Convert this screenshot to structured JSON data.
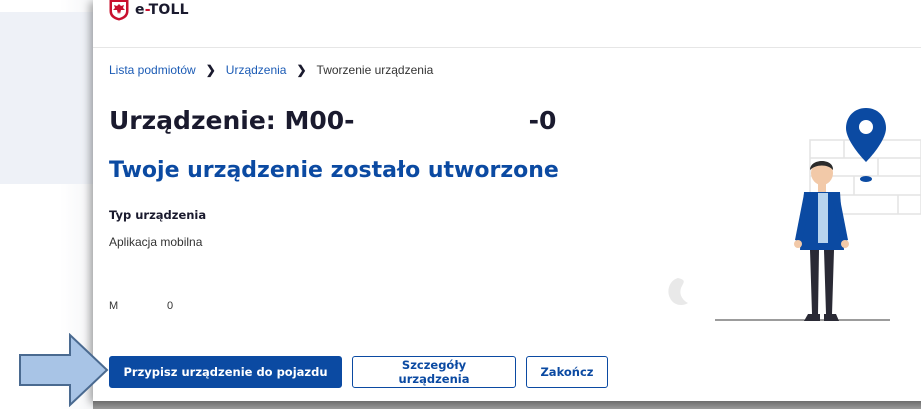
{
  "app": {
    "logo_text": "e-TOLL",
    "logo_prefix": "e",
    "logo_dash": "-",
    "logo_suffix": "TOLL"
  },
  "breadcrumb": {
    "items": [
      {
        "label": "Lista podmiotów",
        "link": true
      },
      {
        "label": "Urządzenia",
        "link": true
      },
      {
        "label": "Tworzenie urządzenia",
        "link": false
      }
    ],
    "separator_icon": "chevron-right-icon"
  },
  "page": {
    "title": "Urządzenie: M00-                    -0",
    "subtitle": "Twoje urządzenie zostało utworzone"
  },
  "device": {
    "type_label": "Typ urządzenia",
    "type_value": "Aplikacja mobilna",
    "serial": "M                0"
  },
  "actions": {
    "assign_label": "Przypisz urządzenie do pojazdu",
    "details_label": "Szczegóły urządzenia",
    "finish_label": "Zakończ"
  },
  "colors": {
    "primary": "#0b4aa2",
    "link": "#1b5bb5",
    "text_dark": "#1a1a2e",
    "logo_red": "#c8102e",
    "annotation_arrow": "#a8c4e6"
  },
  "icons": {
    "logo": "polish-eagle-logo-icon",
    "illustration": "person-with-map-pin-illustration",
    "pointer": "annotation-arrow-icon"
  }
}
